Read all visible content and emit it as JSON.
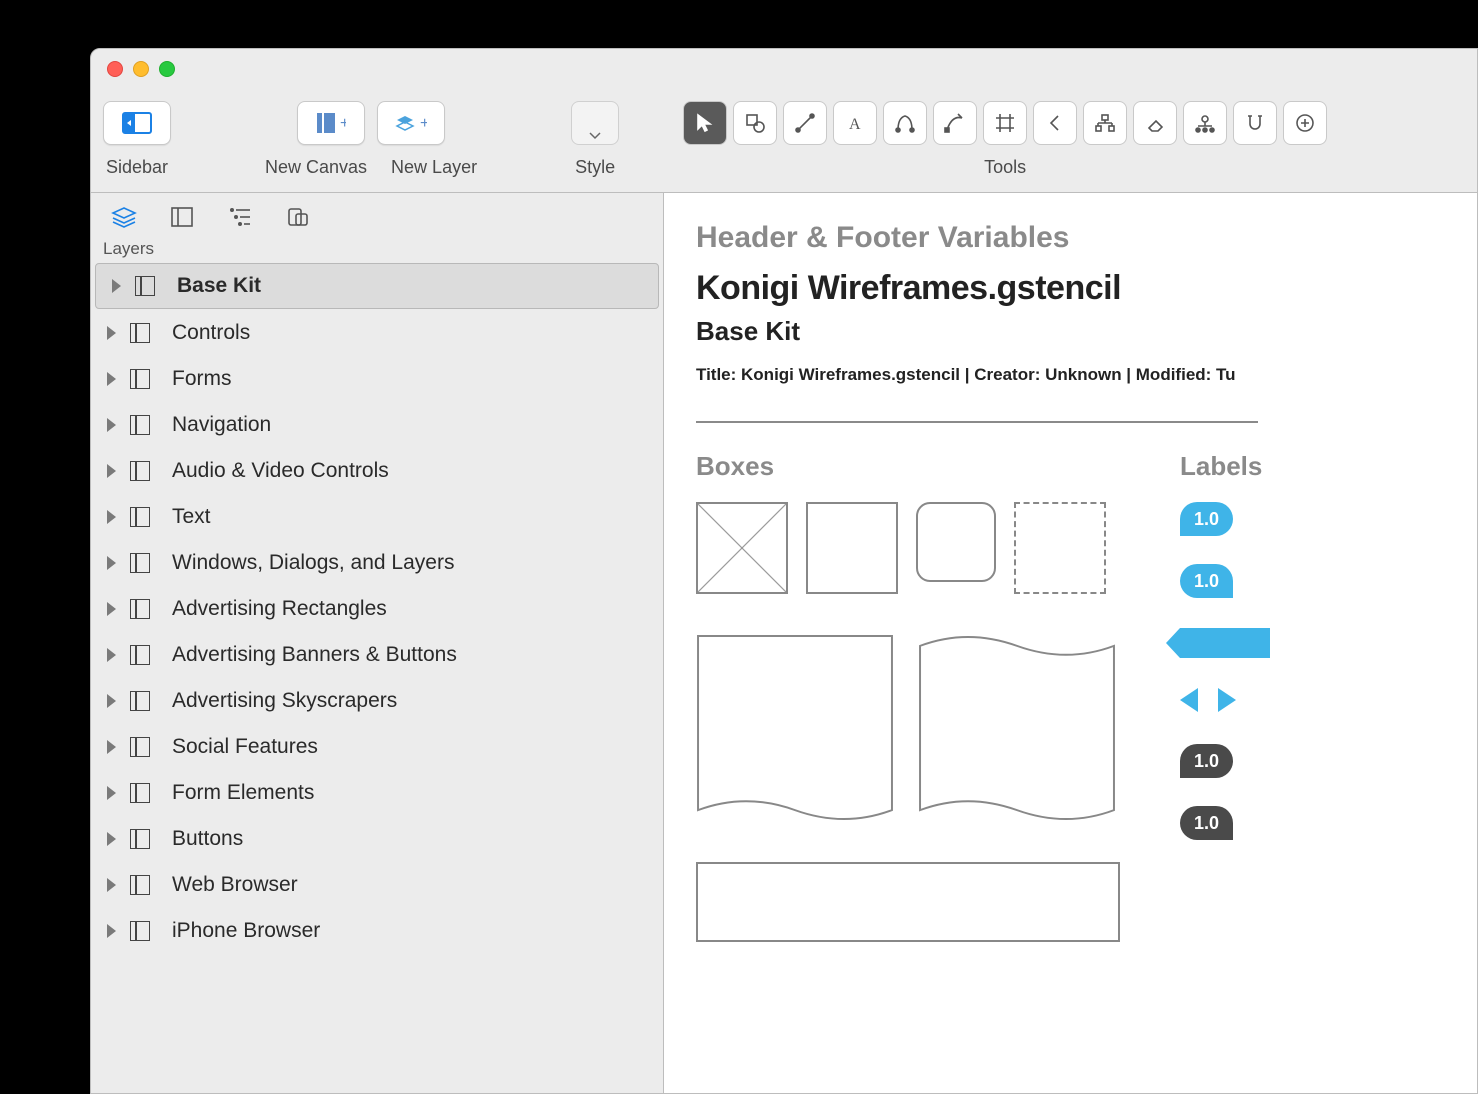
{
  "toolbar": {
    "sidebar_label": "Sidebar",
    "new_canvas_label": "New Canvas",
    "new_layer_label": "New Layer",
    "style_label": "Style",
    "tools_label": "Tools"
  },
  "sidebar": {
    "section_label": "Layers",
    "items": [
      {
        "label": "Base Kit",
        "selected": true
      },
      {
        "label": "Controls"
      },
      {
        "label": "Forms"
      },
      {
        "label": "Navigation"
      },
      {
        "label": "Audio & Video Controls"
      },
      {
        "label": "Text"
      },
      {
        "label": "Windows, Dialogs, and Layers"
      },
      {
        "label": "Advertising Rectangles"
      },
      {
        "label": "Advertising Banners & Buttons"
      },
      {
        "label": "Advertising Skyscrapers"
      },
      {
        "label": "Social Features"
      },
      {
        "label": "Form Elements"
      },
      {
        "label": "Buttons"
      },
      {
        "label": "Web Browser"
      },
      {
        "label": "iPhone Browser"
      }
    ]
  },
  "canvas": {
    "section_heading": "Header & Footer Variables",
    "document_title": "Konigi Wireframes.gstencil",
    "subtitle": "Base Kit",
    "meta_line": "Title: Konigi Wireframes.gstencil  |  Creator: Unknown  |  Modified: Tu",
    "boxes_heading": "Boxes",
    "labels_heading": "Labels",
    "label_values": [
      "1.0",
      "1.0",
      "1.0",
      "1.0"
    ]
  }
}
